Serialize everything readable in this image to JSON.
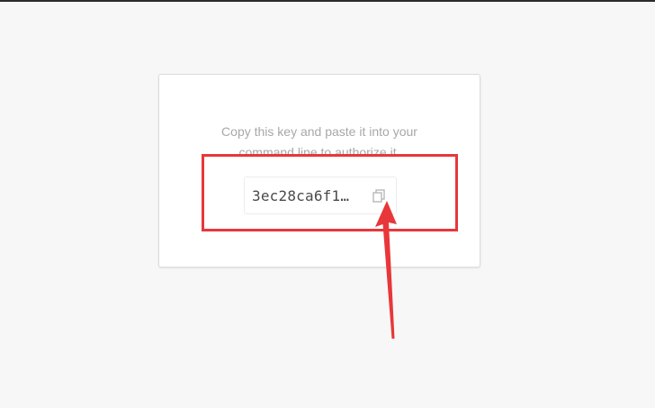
{
  "card": {
    "instruction_line1": "Copy this key and paste it into your",
    "instruction_line2": "command line to authorize it."
  },
  "key": {
    "value": "3ec28ca6f1…"
  },
  "icons": {
    "copy": "copy-icon"
  },
  "colors": {
    "annotation_red": "#e8373a",
    "background": "#f7f7f7",
    "muted_text": "#a8a8a8"
  }
}
